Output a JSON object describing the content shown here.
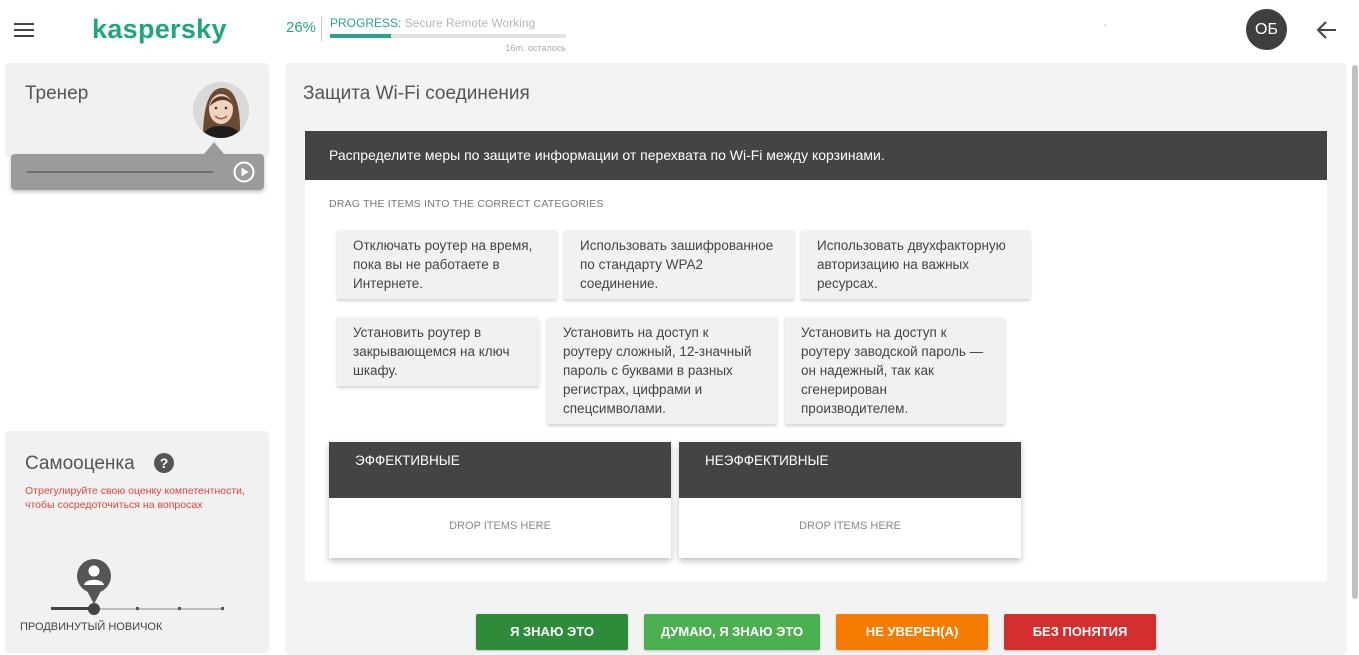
{
  "header": {
    "logo": "kaspersky",
    "progress_percent_text": "26%",
    "progress_value": 0.26,
    "progress_label": "PROGRESS:",
    "course_name": "Secure Remote Working",
    "remaining": "16m. осталось",
    "user_initials": "ОБ"
  },
  "trainer": {
    "title": "Тренер"
  },
  "self_assessment": {
    "title": "Самооценка",
    "help": "?",
    "hint": "Отрегулируйте свою оценку компетентности, чтобы сосредоточиться на вопросах",
    "level_label": "ПРОДВИНУТЫЙ НОВИЧОК",
    "level_index": 1,
    "level_count": 5
  },
  "main": {
    "title": "Защита Wi-Fi соединения",
    "task_header": "Распределите меры по защите информации от перехвата по Wi-Fi между корзинами.",
    "instruction": "DRAG THE ITEMS INTO THE CORRECT CATEGORIES",
    "items": [
      "Отключать роутер на время, пока вы не работаете в Интернете.",
      "Использовать зашифрованное по стандарту WPA2 соединение.",
      "Использовать двухфакторную авторизацию на важных ресурсах.",
      "Установить роутер в закрывающемся на ключ шкафу.",
      "Установить на доступ к роутеру сложный, 12-значный пароль с буквами в разных регистрах, цифрами и спецсимволами.",
      "Установить на доступ к роутеру заводской пароль — он надежный, так как сгенерирован производителем."
    ],
    "baskets": [
      {
        "title": "ЭФФЕКТИВНЫЕ",
        "drop_text": "DROP ITEMS HERE"
      },
      {
        "title": "НЕЭФФЕКТИВНЫЕ",
        "drop_text": "DROP ITEMS HERE"
      }
    ]
  },
  "confidence_buttons": [
    {
      "label": "Я ЗНАЮ ЭТО",
      "color": "#2e8b3a"
    },
    {
      "label": "ДУМАЮ, Я ЗНАЮ ЭТО",
      "color": "#4caf50"
    },
    {
      "label": "НЕ УВЕРЕН(А)",
      "color": "#f57c00"
    },
    {
      "label": "БЕЗ ПОНЯТИЯ",
      "color": "#d32f2f"
    }
  ],
  "colors": {
    "brand": "#1fa584",
    "progress": "#29a48a",
    "dark_header": "#444444",
    "hint_red": "#e0443c"
  },
  "icons": {
    "menu": "menu-icon",
    "back": "arrow-left-icon",
    "play": "play-circle-icon",
    "help": "question-circle-icon",
    "level_marker": "user-marker-icon"
  }
}
